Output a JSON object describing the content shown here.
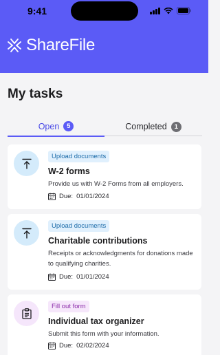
{
  "status_bar": {
    "time": "9:41"
  },
  "header": {
    "brand": "ShareFile"
  },
  "page": {
    "title": "My tasks"
  },
  "tabs": [
    {
      "label": "Open",
      "count": "5"
    },
    {
      "label": "Completed",
      "count": "1"
    }
  ],
  "due_label": "Due:",
  "tasks": [
    {
      "tag": "Upload documents",
      "name": "W-2 forms",
      "description": "Provide us with W-2 Forms from all employers.",
      "due_date": "01/01/2024",
      "icon": "upload-icon"
    },
    {
      "tag": "Upload documents",
      "name": "Charitable contributions",
      "description": "Receipts or acknowledgments for donations made to qualifying charities.",
      "due_date": "01/01/2024",
      "icon": "upload-icon"
    },
    {
      "tag": "Fill out form",
      "name": "Individual tax organizer",
      "description": "Submit this form with your information.",
      "due_date": "02/02/2024",
      "icon": "clipboard-icon"
    }
  ],
  "colors": {
    "brand": "#5b5bf6",
    "upload_tag": "#e0f0fd",
    "form_tag": "#f6e7fb"
  }
}
